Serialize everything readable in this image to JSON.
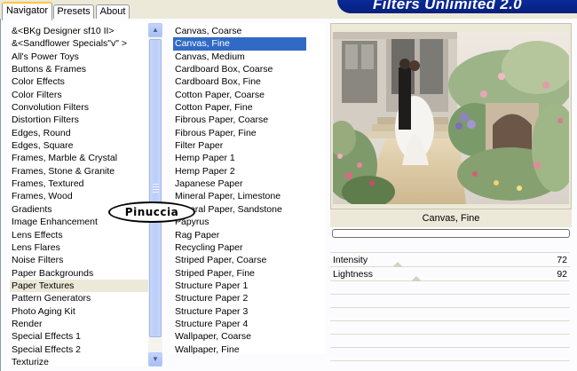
{
  "tabs": [
    {
      "label": "Navigator",
      "active": true
    },
    {
      "label": "Presets",
      "active": false
    },
    {
      "label": "About",
      "active": false
    }
  ],
  "app_title": "Filters Unlimited 2.0",
  "categories": [
    "&<BKg Designer sf10 II>",
    "&<Sandflower Specials\"v\" >",
    "All's Power Toys",
    "Buttons & Frames",
    "Color Effects",
    "Color Filters",
    "Convolution Filters",
    "Distortion Filters",
    "Edges, Round",
    "Edges, Square",
    "Frames, Marble & Crystal",
    "Frames, Stone & Granite",
    "Frames, Textured",
    "Frames, Wood",
    "Gradients",
    "Image Enhancement",
    "Lens Effects",
    "Lens Flares",
    "Noise Filters",
    "Paper Backgrounds",
    "Paper Textures",
    "Pattern Generators",
    "Photo Aging Kit",
    "Render",
    "Special Effects 1",
    "Special Effects 2",
    "Texturize"
  ],
  "selected_category_index": 20,
  "filters": [
    "Canvas, Coarse",
    "Canvas, Fine",
    "Canvas, Medium",
    "Cardboard Box, Coarse",
    "Cardboard Box, Fine",
    "Cotton Paper, Coarse",
    "Cotton Paper, Fine",
    "Fibrous Paper, Coarse",
    "Fibrous Paper, Fine",
    "Filter Paper",
    "Hemp Paper 1",
    "Hemp Paper 2",
    "Japanese Paper",
    "Mineral Paper, Limestone",
    "Mineral Paper, Sandstone",
    "Papyrus",
    "Rag Paper",
    "Recycling Paper",
    "Striped Paper, Coarse",
    "Striped Paper, Fine",
    "Structure Paper 1",
    "Structure Paper 2",
    "Structure Paper 3",
    "Structure Paper 4",
    "Wallpaper, Coarse",
    "Wallpaper, Fine"
  ],
  "selected_filter_index": 1,
  "watermark_text": "Pinuccia",
  "preview_caption": "Canvas, Fine",
  "progress": 0,
  "sliders": [
    {
      "label": "Intensity",
      "value": "72",
      "fraction": 0.28
    },
    {
      "label": "Lightness",
      "value": "92",
      "fraction": 0.36
    }
  ],
  "colors": {
    "selection": "#316ac5",
    "banner": "#0a2a9a",
    "window": "#ece9d8"
  },
  "icons": {
    "scroll_up": "chevron-up-icon",
    "scroll_down": "chevron-down-icon"
  }
}
